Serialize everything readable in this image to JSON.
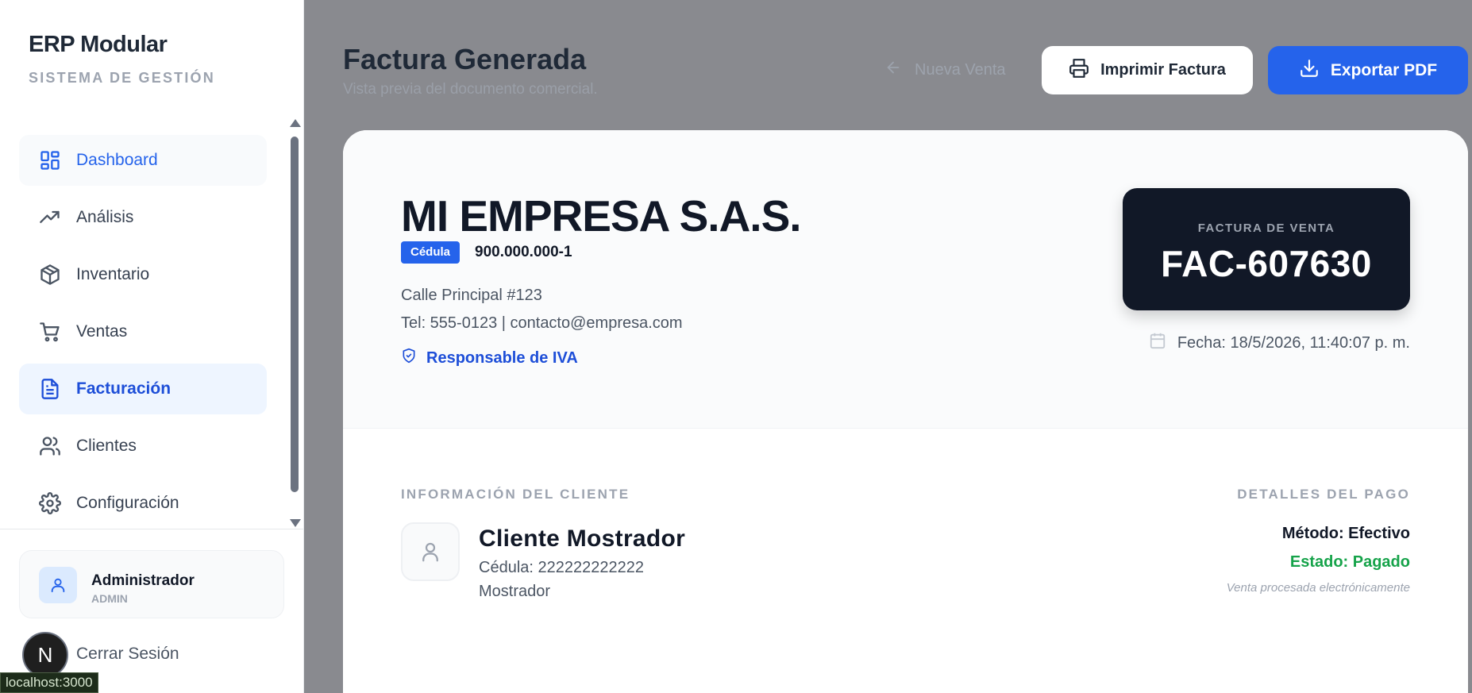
{
  "brand": {
    "title": "ERP Modular",
    "subtitle": "SISTEMA DE GESTIÓN"
  },
  "sidebar": {
    "items": [
      {
        "label": "Dashboard",
        "icon": "dashboard-icon"
      },
      {
        "label": "Análisis",
        "icon": "trending-up-icon"
      },
      {
        "label": "Inventario",
        "icon": "package-icon"
      },
      {
        "label": "Ventas",
        "icon": "cart-icon"
      },
      {
        "label": "Facturación",
        "icon": "file-text-icon"
      },
      {
        "label": "Clientes",
        "icon": "users-icon"
      },
      {
        "label": "Configuración",
        "icon": "gear-icon"
      }
    ],
    "active": "Facturación"
  },
  "user": {
    "name": "Administrador",
    "role": "ADMIN",
    "logout_label": "Cerrar Sesión"
  },
  "overlay": {
    "badge_letter": "N",
    "url_tooltip": "localhost:3000"
  },
  "header": {
    "title": "Factura Generada",
    "subtitle": "Vista previa del documento comercial.",
    "back_label": "Nueva Venta",
    "print_label": "Imprimir Factura",
    "pdf_label": "Exportar PDF"
  },
  "invoice": {
    "company": "MI EMPRESA S.A.S.",
    "id_type": "Cédula",
    "id_number": "900.000.000-1",
    "address": "Calle Principal #123",
    "contact": "Tel: 555-0123 | contacto@empresa.com",
    "tax_regime": "Responsable de IVA",
    "doc_label": "FACTURA DE VENTA",
    "doc_number": "FAC-607630",
    "date": "Fecha: 18/5/2026, 11:40:07 p. m.",
    "client_heading": "INFORMACIÓN DEL CLIENTE",
    "client_name": "Cliente Mostrador",
    "client_id": "Cédula: 222222222222",
    "client_type": "Mostrador",
    "payment_heading": "DETALLES DEL PAGO",
    "payment_method": "Método: Efectivo",
    "payment_status": "Estado: Pagado",
    "payment_note": "Venta procesada electrónicamente"
  },
  "colors": {
    "accent": "#2563eb",
    "dark": "#111827",
    "success": "#16a34a",
    "overlay": "#898a8f"
  }
}
